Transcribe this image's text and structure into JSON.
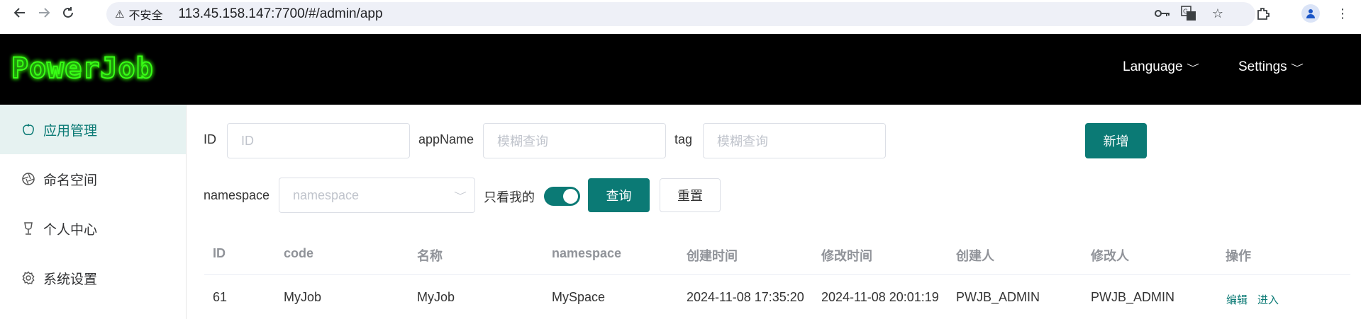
{
  "browser": {
    "insecure_label": "不安全",
    "url": "113.45.158.147:7700/#/admin/app"
  },
  "header": {
    "logo_text": "PowerJob",
    "language_label": "Language",
    "settings_label": "Settings"
  },
  "sidebar": {
    "items": [
      {
        "label": "应用管理",
        "icon": "apple-icon",
        "active": true
      },
      {
        "label": "命名空间",
        "icon": "aperture-icon",
        "active": false
      },
      {
        "label": "个人中心",
        "icon": "goblet-icon",
        "active": false
      },
      {
        "label": "系统设置",
        "icon": "gear-icon",
        "active": false
      }
    ]
  },
  "filters": {
    "id_label": "ID",
    "id_placeholder": "ID",
    "appname_label": "appName",
    "appname_placeholder": "模糊查询",
    "tag_label": "tag",
    "tag_placeholder": "模糊查询",
    "add_button": "新增",
    "namespace_label": "namespace",
    "namespace_placeholder": "namespace",
    "only_mine_label": "只看我的",
    "only_mine_on": true,
    "query_button": "查询",
    "reset_button": "重置"
  },
  "table": {
    "columns": [
      "ID",
      "code",
      "名称",
      "namespace",
      "创建时间",
      "修改时间",
      "创建人",
      "修改人",
      "操作"
    ],
    "rows": [
      {
        "id": "61",
        "code": "MyJob",
        "name": "MyJob",
        "namespace": "MySpace",
        "created_at": "2024-11-08 17:35:20",
        "modified_at": "2024-11-08 20:01:19",
        "creator": "PWJB_ADMIN",
        "modifier": "PWJB_ADMIN",
        "actions": [
          "编辑",
          "进入"
        ]
      }
    ]
  },
  "colors": {
    "primary": "#0b7a75",
    "header_bg": "#000000",
    "logo_glow": "#39ff14",
    "active_bg": "#e6f2f1"
  }
}
